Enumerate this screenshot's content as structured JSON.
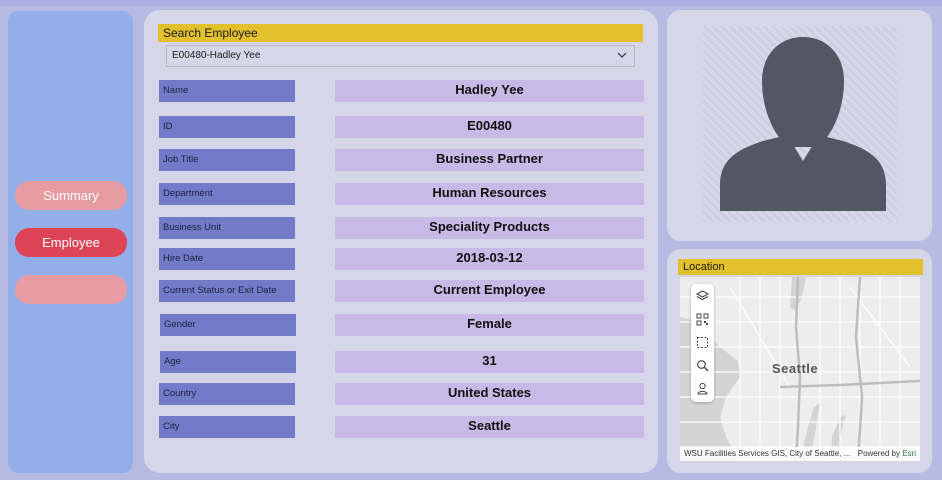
{
  "nav": {
    "summary": "Summary",
    "employee": "Employee",
    "blank": ""
  },
  "search": {
    "title": "Search Employee",
    "selected": "E00480-Hadley Yee"
  },
  "fields": [
    {
      "label": "Name",
      "value": "Hadley Yee"
    },
    {
      "label": "ID",
      "value": "E00480"
    },
    {
      "label": "Job Title",
      "value": "Business Partner"
    },
    {
      "label": "Department",
      "value": "Human Resources"
    },
    {
      "label": "Business Unit",
      "value": "Speciality Products"
    },
    {
      "label": "Hire Date",
      "value": "2018-03-12"
    },
    {
      "label": "Current Status or Exit Date",
      "value": "Current Employee"
    },
    {
      "label": "Gender",
      "value": "Female"
    },
    {
      "label": "Age",
      "value": "31"
    },
    {
      "label": "Country",
      "value": "United States"
    },
    {
      "label": "City",
      "value": "Seattle"
    }
  ],
  "location": {
    "title": "Location",
    "map_label": "Seattle",
    "attribution": "WSU Facilities Services GIS, City of Seattle, ...",
    "powered_by": "Powered by",
    "esri": "Esri"
  },
  "icons": {
    "photo": "person-silhouette-icon",
    "tools": [
      "layers-icon",
      "qr-select-icon",
      "rectangle-select-icon",
      "search-icon",
      "person-locate-icon"
    ]
  },
  "colors": {
    "background": "#b7bbe4",
    "sidebar": "#94aeea",
    "panel": "#d5d7e8",
    "title_bar": "#e2c12c",
    "label": "#717bc8",
    "value": "#c9b9e6",
    "nav_active": "#dd4556",
    "nav_inactive": "#e79ba2"
  }
}
